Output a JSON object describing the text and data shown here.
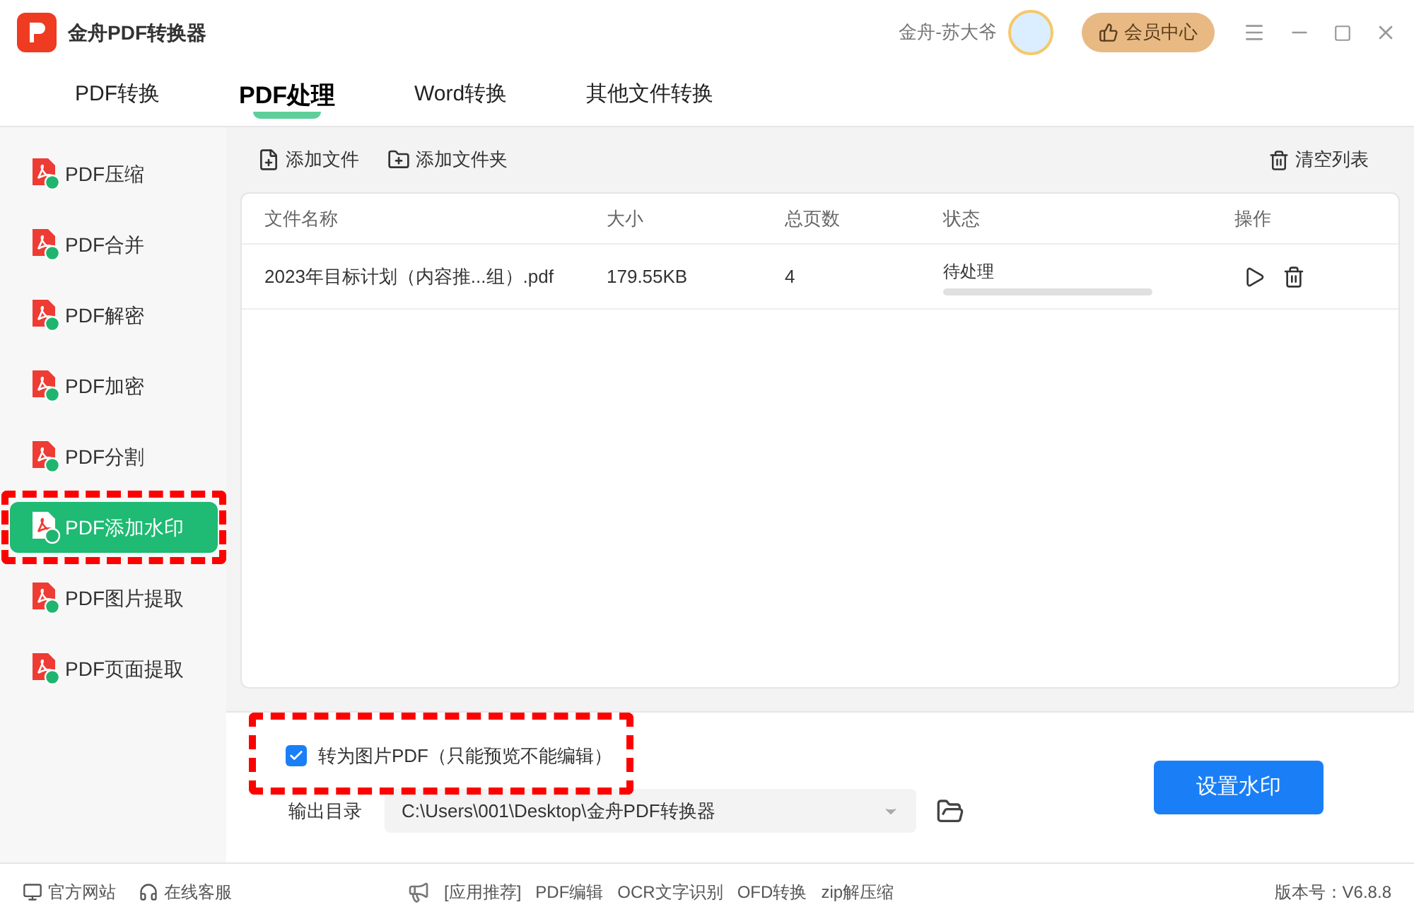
{
  "app": {
    "title": "金舟PDF转换器",
    "user": "金舟-苏大爷",
    "vip_button": "会员中心"
  },
  "tabs": [
    {
      "label": "PDF转换",
      "selected": false
    },
    {
      "label": "PDF处理",
      "selected": true
    },
    {
      "label": "Word转换",
      "selected": false
    },
    {
      "label": "其他文件转换",
      "selected": false
    }
  ],
  "sidebar": {
    "items": [
      {
        "label": "PDF压缩",
        "selected": false
      },
      {
        "label": "PDF合并",
        "selected": false
      },
      {
        "label": "PDF解密",
        "selected": false
      },
      {
        "label": "PDF加密",
        "selected": false
      },
      {
        "label": "PDF分割",
        "selected": false
      },
      {
        "label": "PDF添加水印",
        "selected": true,
        "highlighted": true
      },
      {
        "label": "PDF图片提取",
        "selected": false
      },
      {
        "label": "PDF页面提取",
        "selected": false
      }
    ]
  },
  "toolbar": {
    "add_file": "添加文件",
    "add_folder": "添加文件夹",
    "clear": "清空列表"
  },
  "table": {
    "columns": [
      "文件名称",
      "大小",
      "总页数",
      "状态",
      "操作"
    ],
    "rows": [
      {
        "name": "2023年目标计划（内容推...组）.pdf",
        "size": "179.55KB",
        "pages": "4",
        "status": "待处理"
      }
    ]
  },
  "options": {
    "image_pdf": {
      "label": "转为图片PDF（只能预览不能编辑）",
      "checked": true,
      "highlighted": true
    },
    "output_label": "输出目录",
    "output_path": "C:\\Users\\001\\Desktop\\金舟PDF转换器",
    "action": "设置水印"
  },
  "status_bar": {
    "website": "官方网站",
    "support": "在线客服",
    "promo": [
      "[应用推荐]",
      "PDF编辑",
      "OCR文字识别",
      "OFD转换",
      "zip解压缩"
    ],
    "version": "版本号：V6.8.8"
  }
}
